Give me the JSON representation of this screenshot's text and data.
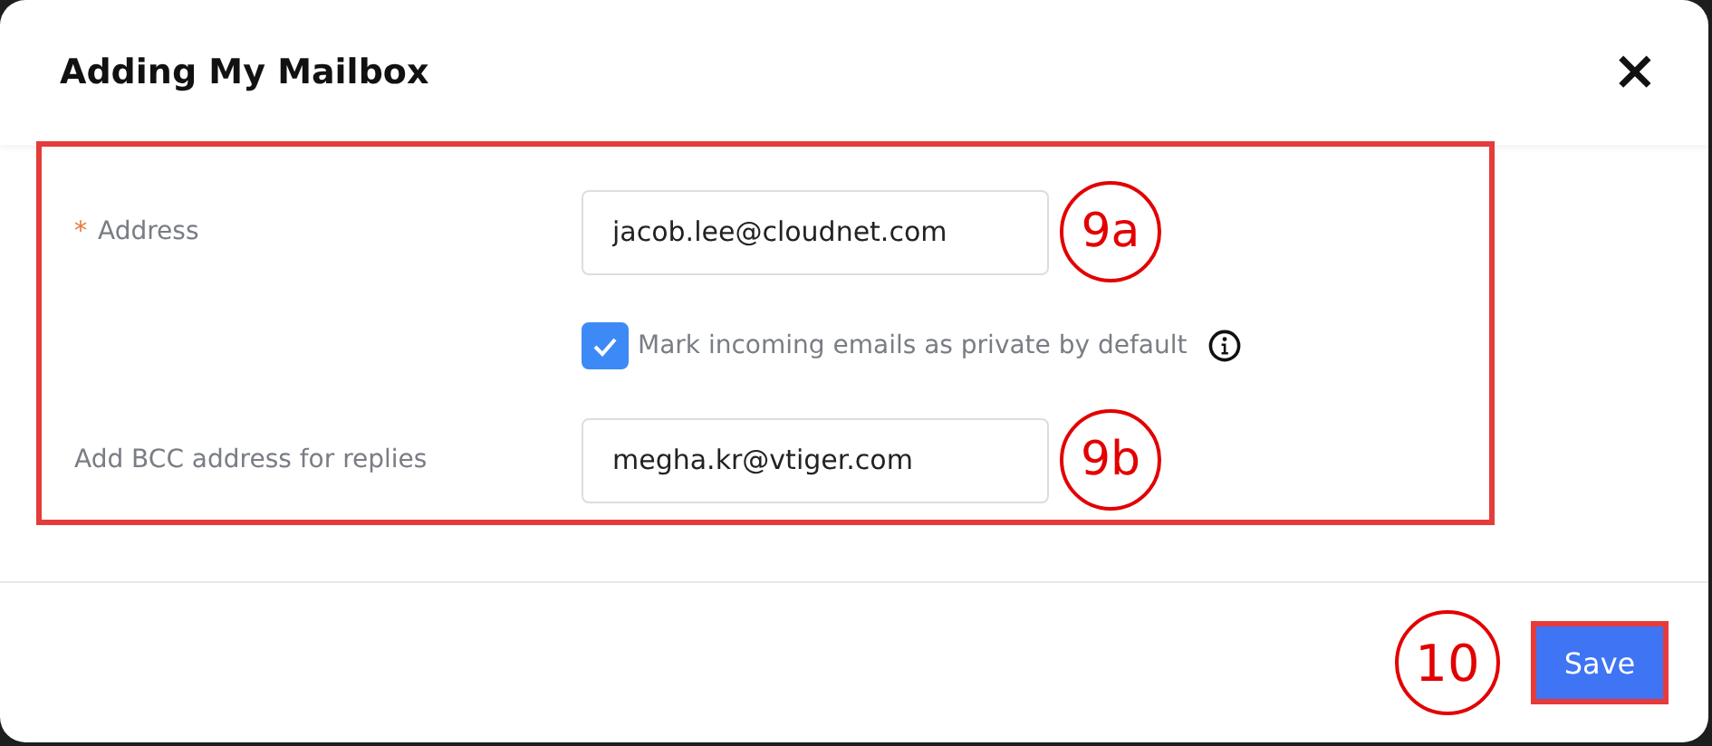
{
  "dialog": {
    "title": "Adding My Mailbox",
    "close_label": "×"
  },
  "form": {
    "fields": [
      {
        "kind": "input",
        "label": "Address",
        "required_mark": "*",
        "value": "jacob.lee@cloudnet.com",
        "callout": "9a"
      },
      {
        "kind": "checkbox",
        "label": "Mark incoming emails as private by default",
        "checked": true
      },
      {
        "kind": "input",
        "label": "Add BCC address for replies",
        "value": "megha.kr@vtiger.com",
        "callout": "9b"
      }
    ]
  },
  "footer": {
    "callout": "10",
    "save_button": "Save"
  }
}
